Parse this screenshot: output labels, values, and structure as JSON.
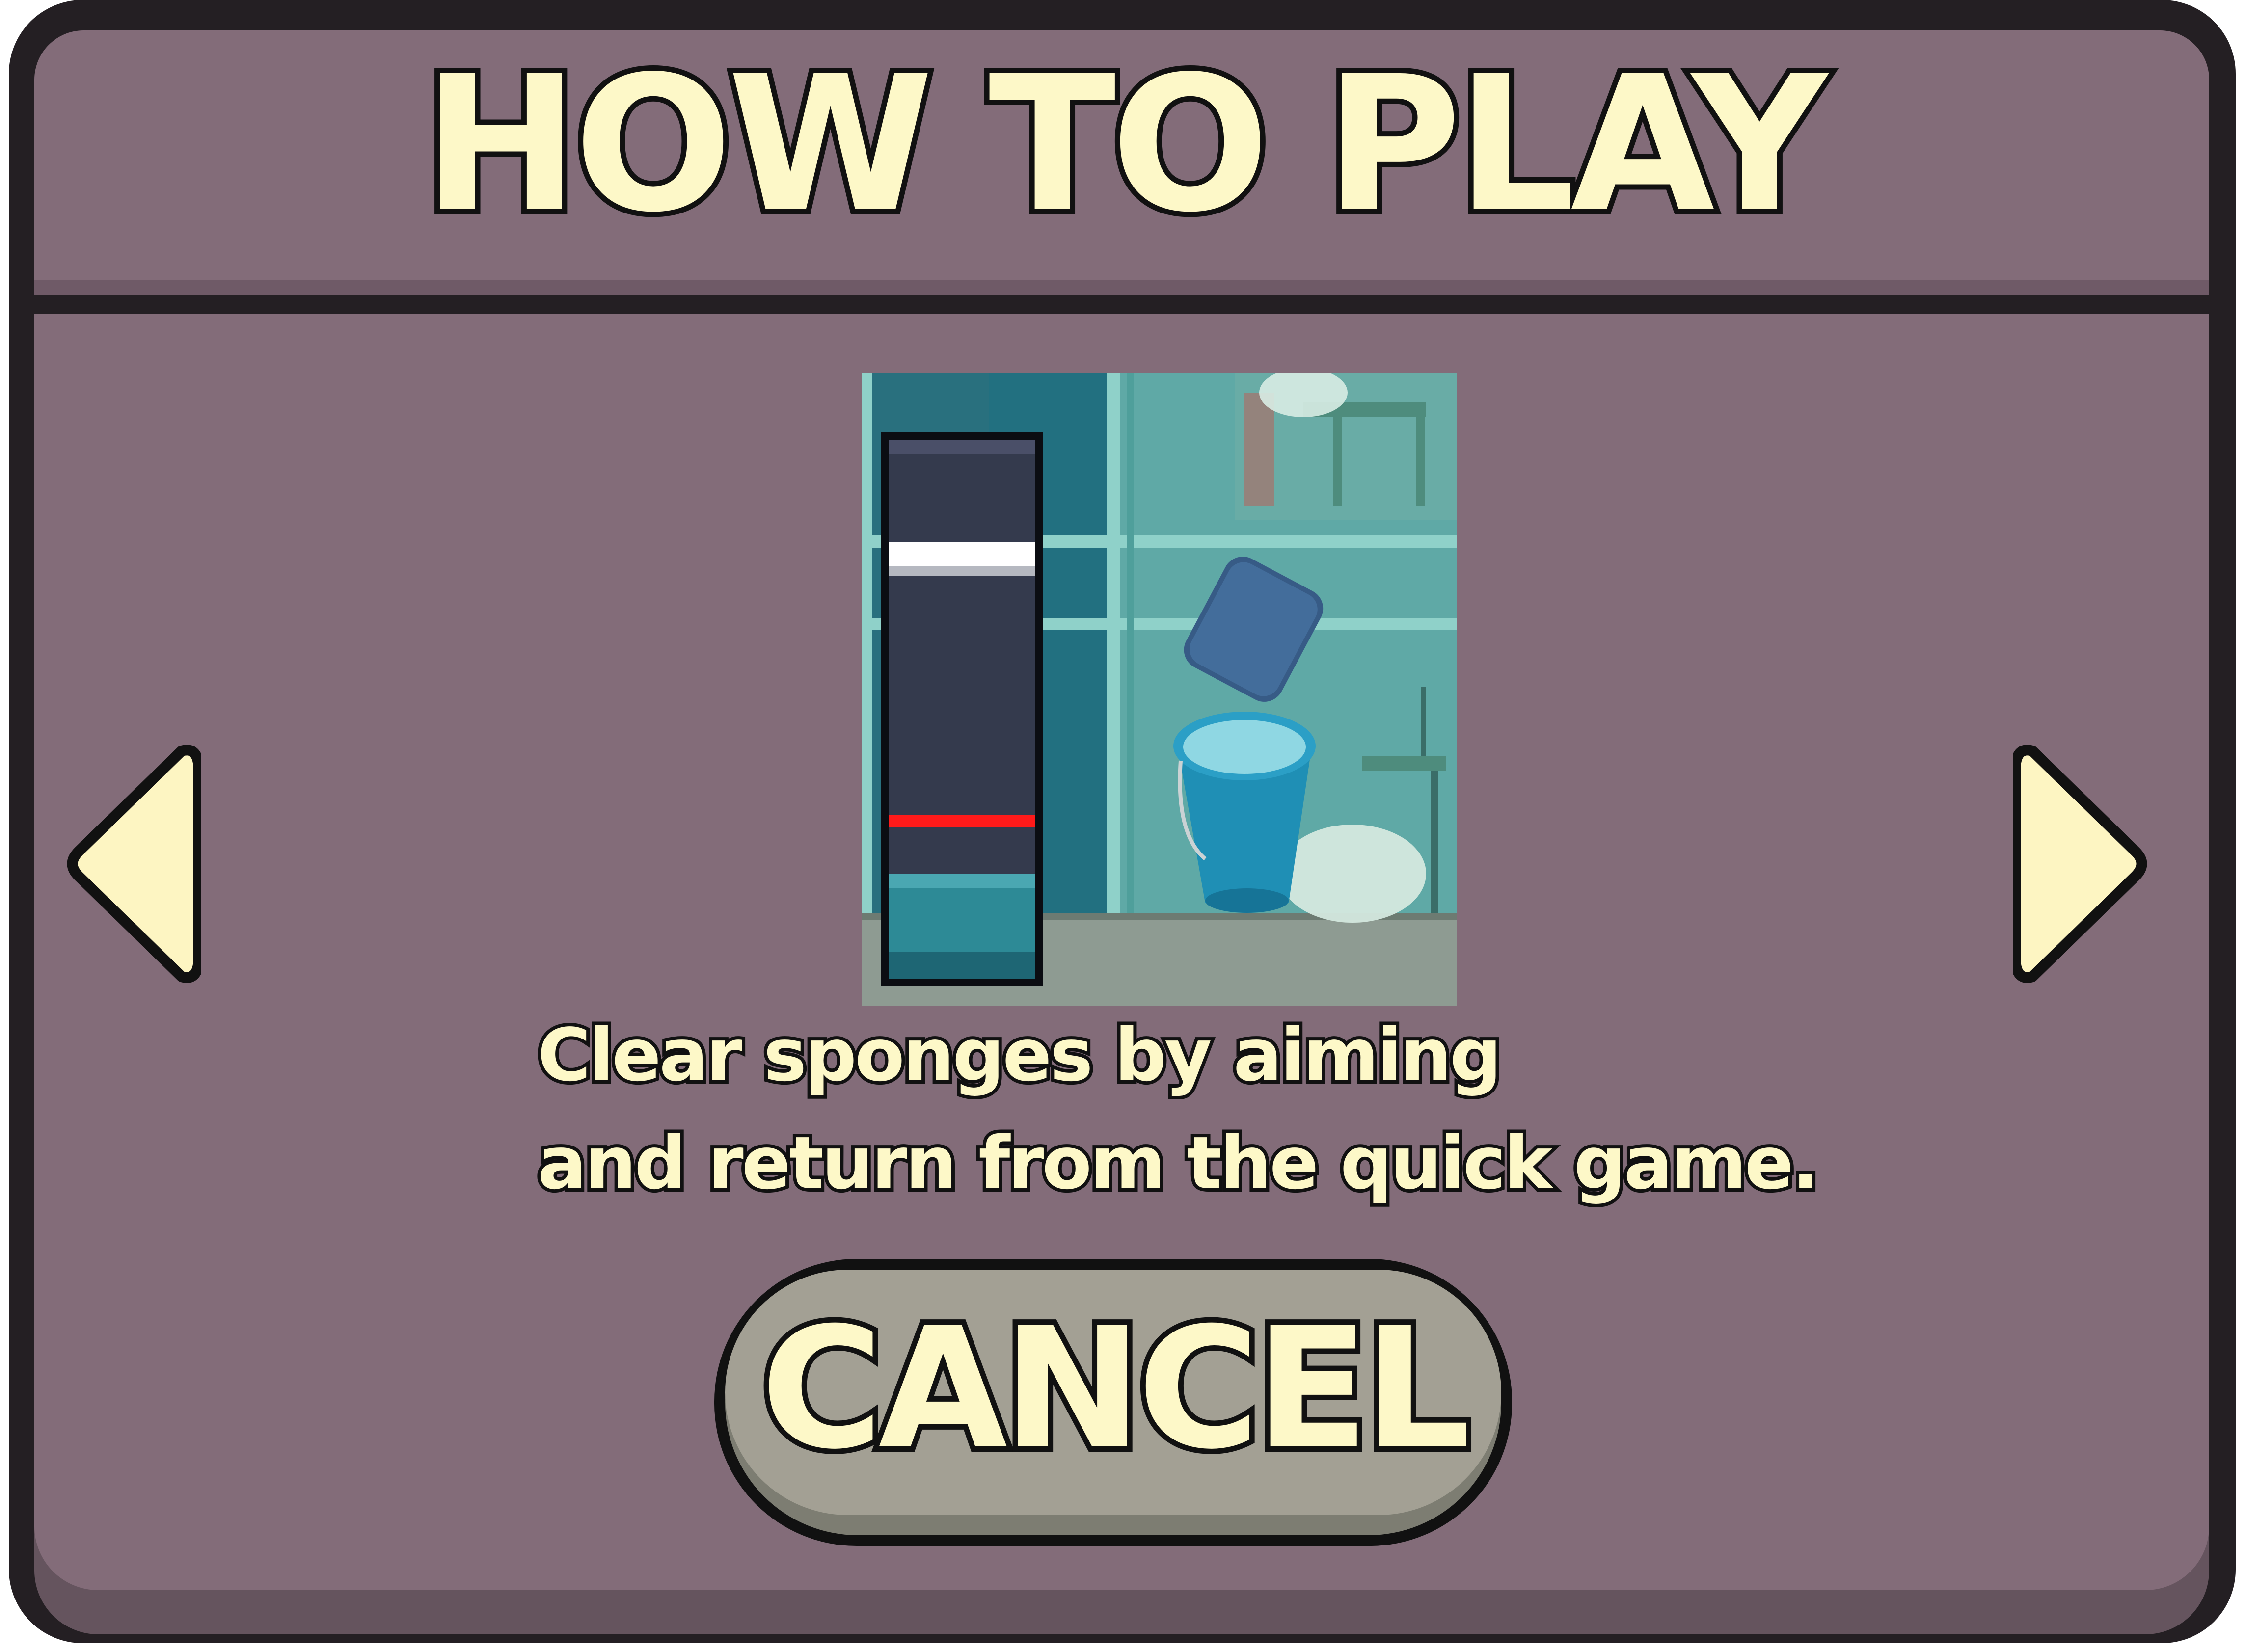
{
  "dialog": {
    "title": "HOW TO PLAY",
    "description_lines": [
      "Clear sponges by aiming",
      "and return from the quick game."
    ],
    "cancel_label": "CANCEL",
    "prev_arrow_icon": "triangle-left-icon",
    "next_arrow_icon": "triangle-right-icon"
  },
  "preview": {
    "elements": [
      "timing-meter",
      "sponge-icon",
      "water-bucket-icon"
    ]
  },
  "colors": {
    "panel": "#836c79",
    "frame": "#241f23",
    "text_fill": "#fdf8c8",
    "text_outline": "#111111",
    "button": "#a3a094",
    "arrow_fill": "#fdf5c2",
    "meter_bg": "#343a4d",
    "meter_marker_white": "#ffffff",
    "meter_marker_red": "#ff1a1a",
    "water": "#2e8a96"
  }
}
